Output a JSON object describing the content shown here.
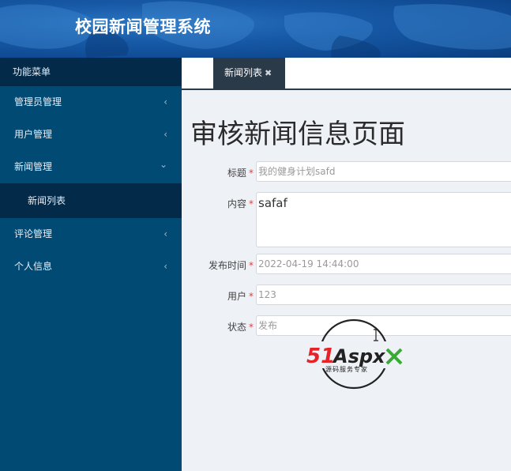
{
  "header": {
    "title": "校园新闻管理系统"
  },
  "sidebar": {
    "menu_title": "功能菜单",
    "items": [
      {
        "label": "管理员管理",
        "chevron": "‹"
      },
      {
        "label": "用户管理",
        "chevron": "‹"
      },
      {
        "label": "新闻管理",
        "chevron": "⌄",
        "expanded": true
      },
      {
        "label": "评论管理",
        "chevron": "‹"
      },
      {
        "label": "个人信息",
        "chevron": "‹"
      }
    ],
    "sub_items": [
      {
        "label": "新闻列表"
      }
    ]
  },
  "tabs": [
    {
      "label": "新闻列表",
      "close": "✖"
    }
  ],
  "main": {
    "page_title": "审核新闻信息页面",
    "required_mark": "*",
    "form": {
      "title_label": "标题",
      "title_value": "我的健身计划safd",
      "content_label": "内容",
      "content_value": "safaf",
      "time_label": "发布时间",
      "time_value": "2022-04-19 14:44:00",
      "user_label": "用户",
      "user_value": "123",
      "status_label": "状态",
      "status_value": "发布"
    }
  },
  "watermark": {
    "logo_text": "51Aspx",
    "tagline": "源码服务专家"
  },
  "colors": {
    "header_bg": "#1759a6",
    "sidebar_bg": "#004a73",
    "sidebar_dark": "#032a49",
    "tab_active": "#2b3a48",
    "required": "#e0403c",
    "logo_red": "#e5242a",
    "logo_green": "#3aa935"
  }
}
